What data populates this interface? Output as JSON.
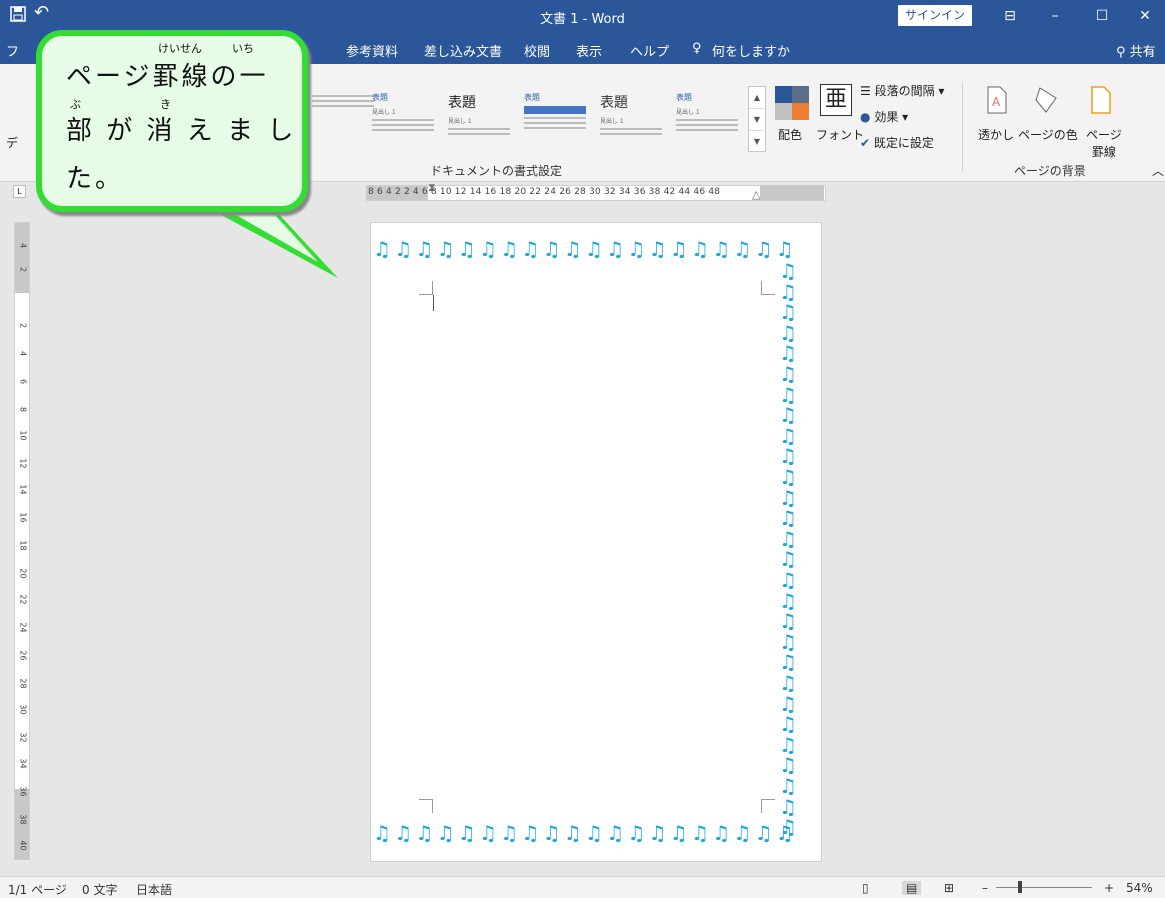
{
  "titlebar": {
    "title": "文書 1 - Word",
    "signin_label": "サインイン",
    "save_icon": "💾"
  },
  "tabs": {
    "file_partial": "フ",
    "items": [
      "参考資料",
      "差し込み文書",
      "校閲",
      "表示",
      "ヘルプ"
    ],
    "tell_me": "何をしますか",
    "share": "共有"
  },
  "ribbon": {
    "styles_left_partial": "デ",
    "style_heading": "表題",
    "style_sub": "見出し 1",
    "group_document_format": "ドキュメントの書式設定",
    "colors_label": "配色",
    "fonts_label": "フォント",
    "paragraph_spacing_label": "段落の間隔",
    "effects_label": "効果",
    "set_default_label": "既定に設定",
    "watermark_label": "透かし",
    "page_color_label": "ページの色",
    "page_borders_label_1": "ページ",
    "page_borders_label_2": "罫線",
    "group_page_background": "ページの背景"
  },
  "ruler": {
    "numbers": "8  6  4  2       2  4  6  8  10 12 14 16 18 20 22 24 26 28 30 32 34 36 38      42 44 46 48",
    "vertical": [
      "4",
      "2",
      "2",
      "4",
      "6",
      "8",
      "10",
      "12",
      "14",
      "16",
      "18",
      "20",
      "22",
      "24",
      "26",
      "28",
      "30",
      "32",
      "34",
      "36",
      "38",
      "40"
    ]
  },
  "callout": {
    "line1": "ページ罫線の一",
    "line2": "部 が 消 え ま し",
    "line3": "た。",
    "ruby_keisen": "けいせん",
    "ruby_ichi": "いち",
    "ruby_bu": "ぶ",
    "ruby_ki": "き"
  },
  "page": {
    "border_glyph": "♫"
  },
  "statusbar": {
    "page_info": "1/1 ページ",
    "word_count": "0 文字",
    "language": "日本語",
    "zoom": "54%"
  },
  "colors": {
    "accent": "#2b579a",
    "callout_border": "#33dd33",
    "callout_fill": "#e6fce6",
    "note": "#1aa5dd"
  }
}
